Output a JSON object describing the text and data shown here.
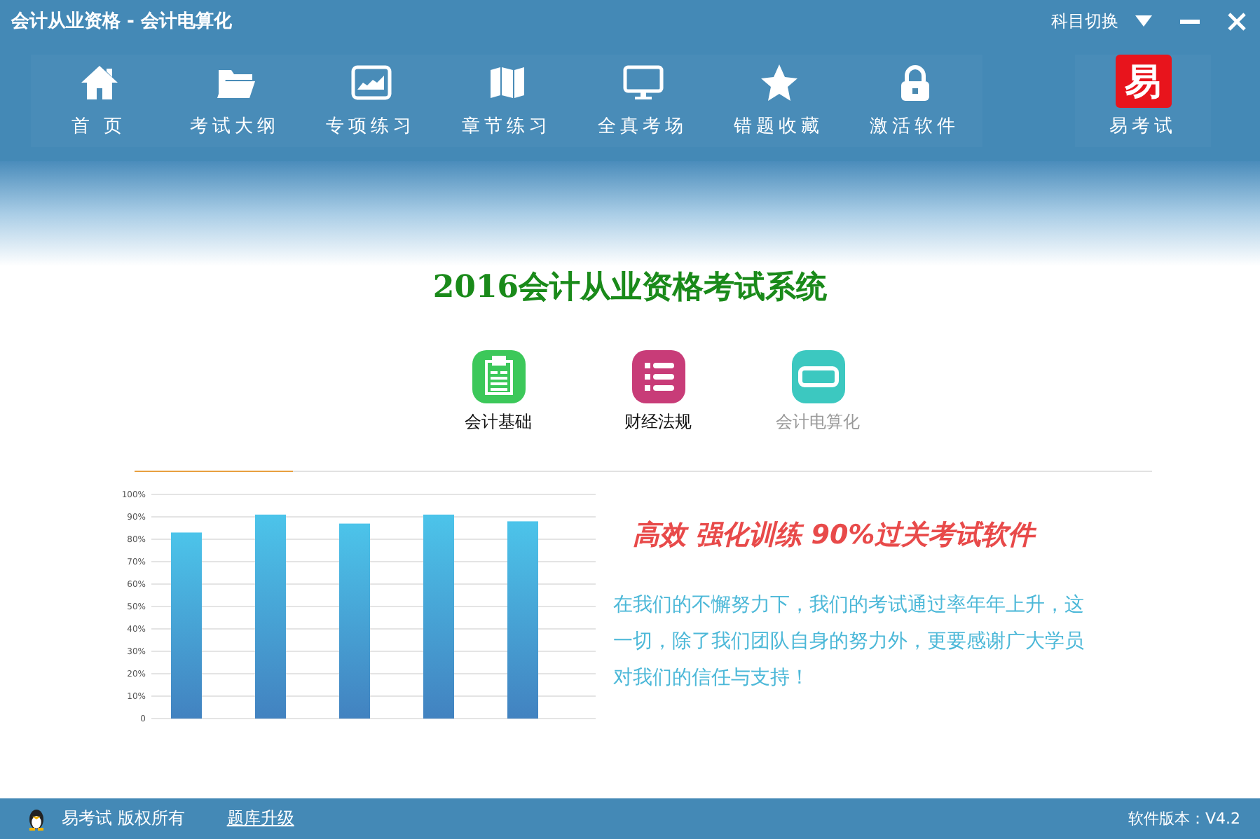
{
  "window": {
    "title": "会计从业资格 - 会计电算化",
    "subject_switch": "科目切换"
  },
  "toolbar": [
    {
      "label": "首 页",
      "kind": "home"
    },
    {
      "label": "考试大纲",
      "kind": "folder"
    },
    {
      "label": "专项练习",
      "kind": "screen"
    },
    {
      "label": "章节练习",
      "kind": "map"
    },
    {
      "label": "全真考场",
      "kind": "monitor"
    },
    {
      "label": "错题收藏",
      "kind": "star"
    },
    {
      "label": "激活软件",
      "kind": "lock"
    },
    {
      "label": "易考试",
      "kind": "logo",
      "logo_text": "易"
    }
  ],
  "heading": "2016会计从业资格考试系统",
  "subjects": [
    {
      "label": "会计基础",
      "kind": "clipboard",
      "color": "#3cc85a",
      "selected": false
    },
    {
      "label": "财经法规",
      "kind": "list",
      "color": "#c83c78",
      "selected": false
    },
    {
      "label": "会计电算化",
      "kind": "card",
      "color": "#3cc8c0",
      "selected": true
    }
  ],
  "chart_data": {
    "type": "bar",
    "values": [
      83,
      91,
      87,
      91,
      88
    ],
    "ylim": [
      0,
      100
    ],
    "grid": true,
    "yticks": [
      {
        "value": 0,
        "label": "0"
      },
      {
        "value": 10,
        "label": "10%"
      },
      {
        "value": 20,
        "label": "20%"
      },
      {
        "value": 30,
        "label": "30%"
      },
      {
        "value": 40,
        "label": "40%"
      },
      {
        "value": 50,
        "label": "50%"
      },
      {
        "value": 60,
        "label": "60%"
      },
      {
        "value": 70,
        "label": "70%"
      },
      {
        "value": 80,
        "label": "80%"
      },
      {
        "value": 90,
        "label": "90%"
      },
      {
        "value": 100,
        "label": "100%"
      }
    ]
  },
  "slogan": "高效 强化训练 90%过关考试软件",
  "description": "在我们的不懈努力下，我们的考试通过率年年上升，这一切，除了我们团队自身的努力外，更要感谢广大学员对我们的信任与支持！",
  "status_bar": {
    "copyright": "易考试 版权所有",
    "upgrade_link": "题库升级",
    "version": "软件版本：V4.2"
  }
}
